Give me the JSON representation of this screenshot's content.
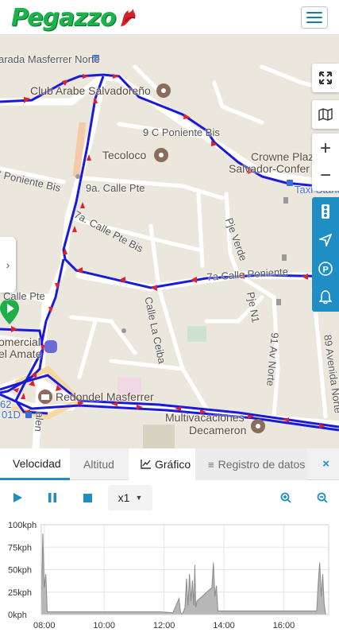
{
  "header": {
    "logo_text": "Pegazzo",
    "menu_icon": "hamburger-icon"
  },
  "map": {
    "streets": {
      "calle_poniente": "9 C Poniente Bis",
      "c_poniente_bis": "C Poniente Bis",
      "calle_pte_9a": "9a. Calle Pte",
      "calle_pte_bis_7a": "7a. Calle Pte Bis",
      "calle_pte": "Calle Pte",
      "calle_poniente_7a": "7a Calle Poniente",
      "calle_la_ceiba": "Calle La Ceiba",
      "pje_verde": "Pje Verde",
      "pje_n1": "Pje N1",
      "av_norte_91": "91 Av Norte",
      "avenida_norte_89": "89 Avenida Norte",
      "parada": "arada Masferrer Norte",
      "falen": "alen"
    },
    "pois": {
      "club_arabe": "Club Arabe Salvadoreño",
      "tecoloco": "Tecoloco",
      "crowne_1": "Crowne Plaz",
      "crowne_2": "Salvador-Confer",
      "taxi": "Taxi Stand",
      "comercial_1": "omercial",
      "comercial_2": "el Amate",
      "redondel": "Redondel Masferrer",
      "multivacaciones_1": "Multivacaciones",
      "multivacaciones_2": "Decameron",
      "stop_62": "62",
      "stop_01d": "01D"
    },
    "controls": [
      "expand-icon",
      "map-icon",
      "zoom-in-icon",
      "zoom-out-icon"
    ],
    "side_tools": [
      "traffic-light-icon",
      "navigation-icon",
      "parking-icon",
      "bell-icon"
    ]
  },
  "tabs": {
    "velocidad": "Velocidad",
    "altitud": "Altitud",
    "grafico": "Gráfico",
    "registro": "Registro de datos",
    "close": "×"
  },
  "playback": {
    "speed": "x1"
  },
  "colors": {
    "accent": "#1f8ec5",
    "route": "#1a1adc",
    "arrows": "#e0202a",
    "logo": "#1bb34a"
  },
  "chart_data": {
    "type": "area",
    "y_ticks": [
      "100kph",
      "75kph",
      "50kph",
      "25kph",
      "0kph"
    ],
    "x_ticks": [
      "08:00",
      "10:00",
      "12:00",
      "14:00",
      "16:00"
    ],
    "ylim": [
      0,
      100
    ],
    "xlim_hours": [
      7.9,
      17.5
    ],
    "series": [
      {
        "values": [
          [
            7.9,
            0
          ],
          [
            7.95,
            90
          ],
          [
            8.0,
            30
          ],
          [
            8.05,
            45
          ],
          [
            8.08,
            20
          ],
          [
            8.1,
            3
          ],
          [
            11.9,
            3
          ],
          [
            12.3,
            2
          ],
          [
            12.5,
            18
          ],
          [
            12.55,
            3
          ],
          [
            12.6,
            0
          ],
          [
            12.65,
            3
          ],
          [
            12.7,
            8
          ],
          [
            12.75,
            40
          ],
          [
            12.8,
            10
          ],
          [
            12.85,
            45
          ],
          [
            12.9,
            15
          ],
          [
            12.95,
            38
          ],
          [
            13.0,
            10
          ],
          [
            13.03,
            55
          ],
          [
            13.06,
            8
          ],
          [
            13.1,
            15
          ],
          [
            13.6,
            30
          ],
          [
            13.65,
            58
          ],
          [
            13.7,
            20
          ],
          [
            13.75,
            32
          ],
          [
            13.8,
            4
          ],
          [
            17.1,
            4
          ],
          [
            17.15,
            35
          ],
          [
            17.2,
            58
          ],
          [
            17.25,
            20
          ],
          [
            17.3,
            45
          ],
          [
            17.35,
            12
          ],
          [
            17.4,
            0
          ],
          [
            17.5,
            0
          ]
        ]
      }
    ]
  }
}
